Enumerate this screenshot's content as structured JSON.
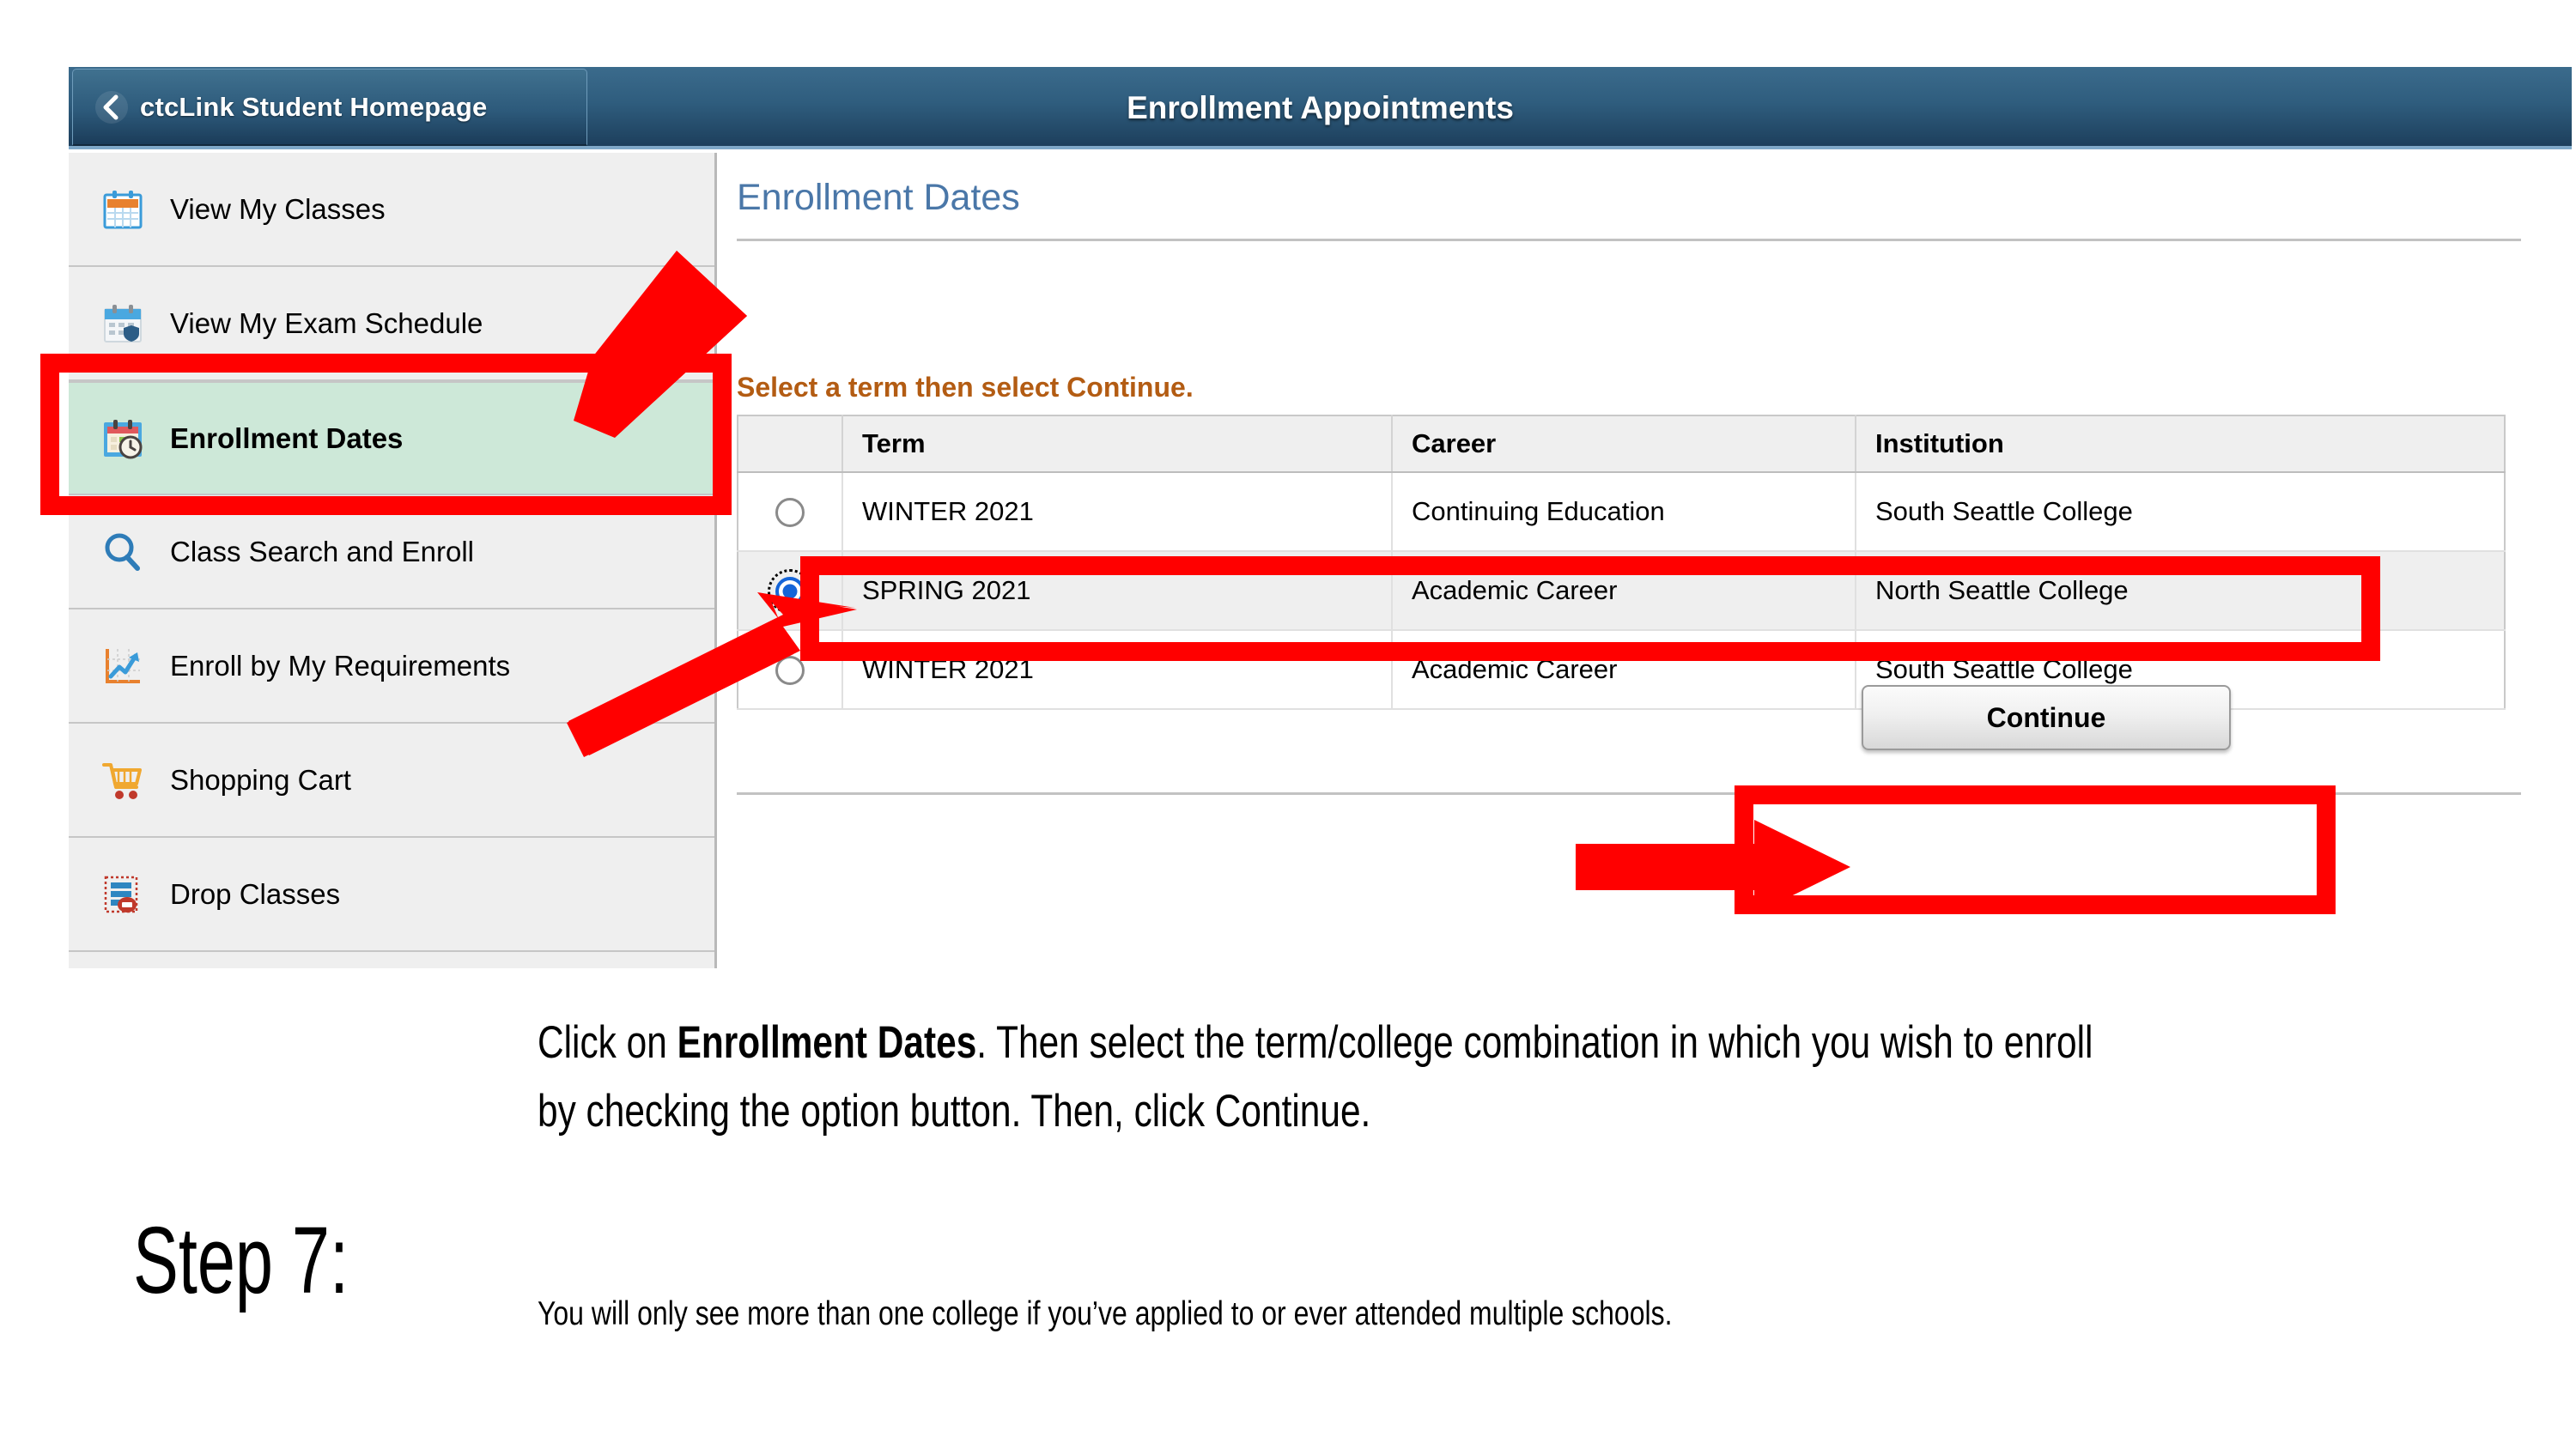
{
  "header": {
    "back_label": "ctcLink Student Homepage",
    "back_icon": "chevron-left-icon",
    "title": "Enrollment Appointments"
  },
  "sidebar": {
    "items": [
      {
        "label": "View My Classes",
        "icon": "calendar-icon",
        "selected": false
      },
      {
        "label": "View My Exam Schedule",
        "icon": "calendar-shield-icon",
        "selected": false
      },
      {
        "label": "Enrollment Dates",
        "icon": "calendar-clock-icon",
        "selected": true
      },
      {
        "label": "Class Search and Enroll",
        "icon": "magnifier-icon",
        "selected": false
      },
      {
        "label": "Enroll by My Requirements",
        "icon": "line-chart-icon",
        "selected": false
      },
      {
        "label": "Shopping Cart",
        "icon": "shopping-cart-icon",
        "selected": false
      },
      {
        "label": "Drop Classes",
        "icon": "drop-classes-icon",
        "selected": false
      }
    ]
  },
  "main": {
    "page_title": "Enrollment Dates",
    "instruction": "Select a term then select Continue.",
    "table": {
      "columns": [
        "",
        "Term",
        "Career",
        "Institution"
      ],
      "rows": [
        {
          "selected": false,
          "term": "WINTER 2021",
          "career": "Continuing Education",
          "institution": "South Seattle College"
        },
        {
          "selected": true,
          "term": "SPRING 2021",
          "career": "Academic Career",
          "institution": "North Seattle College"
        },
        {
          "selected": false,
          "term": "WINTER 2021",
          "career": "Academic Career",
          "institution": "South Seattle College"
        }
      ]
    },
    "continue_label": "Continue"
  },
  "caption": {
    "step": "Step 7:",
    "body_part1": "Click on ",
    "body_bold": "Enrollment Dates",
    "body_part2": ". Then select the term/college combination in which you wish to enroll by checking the option button. Then, click Continue.",
    "note": "You will only see more than one college if you’ve applied to or ever attended multiple schools."
  },
  "colors": {
    "header_blue": "#2f5d7e",
    "title_blue": "#4a77a8",
    "instruction_orange": "#b35c13",
    "selected_row_green": "#cde8d8",
    "annotation_red": "#ff0000",
    "radio_blue": "#1565d8"
  }
}
